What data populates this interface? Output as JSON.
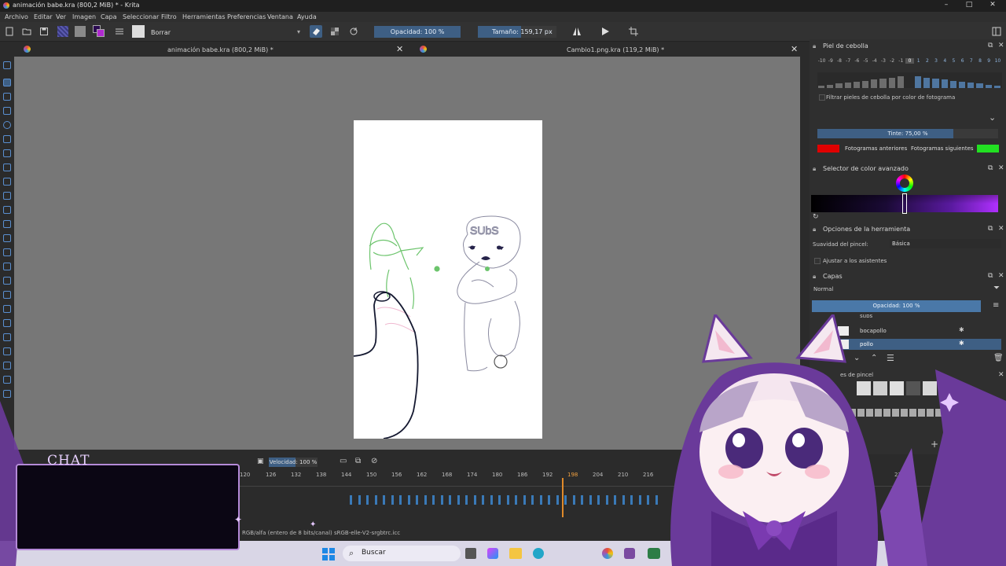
{
  "window": {
    "title": "animación babe.kra (800,2 MiB) * - Krita",
    "controls": [
      "–",
      "□",
      "✕"
    ]
  },
  "menu": [
    "Archivo",
    "Editar",
    "Ver",
    "Imagen",
    "Capa",
    "Seleccionar",
    "Filtro",
    "Herramientas",
    "Preferencias",
    "Ventana",
    "Ayuda"
  ],
  "toolbar": {
    "preset": "Borrar",
    "opacity": "Opacidad: 100 %",
    "size_label": "Tamaño:",
    "size_value": "159,17 px"
  },
  "tabs": [
    {
      "label": "animación babe.kra (800,2 MiB) *"
    },
    {
      "label": "Cambio1.png.kra (119,2 MiB) *"
    }
  ],
  "onion": {
    "title": "Piel de cebolla",
    "frames": [
      "-10",
      "-9",
      "-8",
      "-7",
      "-6",
      "-5",
      "-4",
      "-3",
      "-2",
      "-1",
      "0",
      "1",
      "2",
      "3",
      "4",
      "5",
      "6",
      "7",
      "8",
      "9",
      "10"
    ],
    "filter_label": "Filtrar pieles de cebolla por color de fotograma",
    "tint": "Tinte: 75,00 %",
    "tint_fill": 0.75,
    "prev_label": "Fotogramas anteriores",
    "next_label": "Fotogramas siguientes",
    "prev_color": "#e00000",
    "next_color": "#22e022"
  },
  "color_selector": {
    "title": "Selector de color avanzado"
  },
  "tool_options": {
    "title": "Opciones de la herramienta",
    "smoothing_label": "Suavidad del pincel:",
    "smoothing_value": "Básica",
    "assistants_label": "Ajustar a los asistentes"
  },
  "layers": {
    "title": "Capas",
    "blend": "Normal",
    "opacity": "Opacidad:  100 %",
    "items": [
      {
        "name": "subs"
      },
      {
        "name": "bocapollo"
      },
      {
        "name": "pollo"
      }
    ]
  },
  "brush_presets": {
    "title": "Preajustes de pincel",
    "visible_title": "es de pincel"
  },
  "timeline": {
    "speed": "Velocidad: 100 %",
    "frames": [
      "120",
      "126",
      "132",
      "138",
      "144",
      "150",
      "156",
      "162",
      "168",
      "174",
      "180",
      "186",
      "192",
      "198",
      "204",
      "210",
      "216",
      "276"
    ],
    "current_frame": 198
  },
  "status": {
    "text": "RGB/alfa (entero de 8 bits/canal)  sRGB-elle-V2-srgbtrc.icc"
  },
  "overlay": {
    "chat_label": "CHAT"
  },
  "taskbar": {
    "search": "Buscar"
  },
  "colors": {
    "accent": "#3e5f84",
    "overlay_purple": "#6a3a9a"
  }
}
